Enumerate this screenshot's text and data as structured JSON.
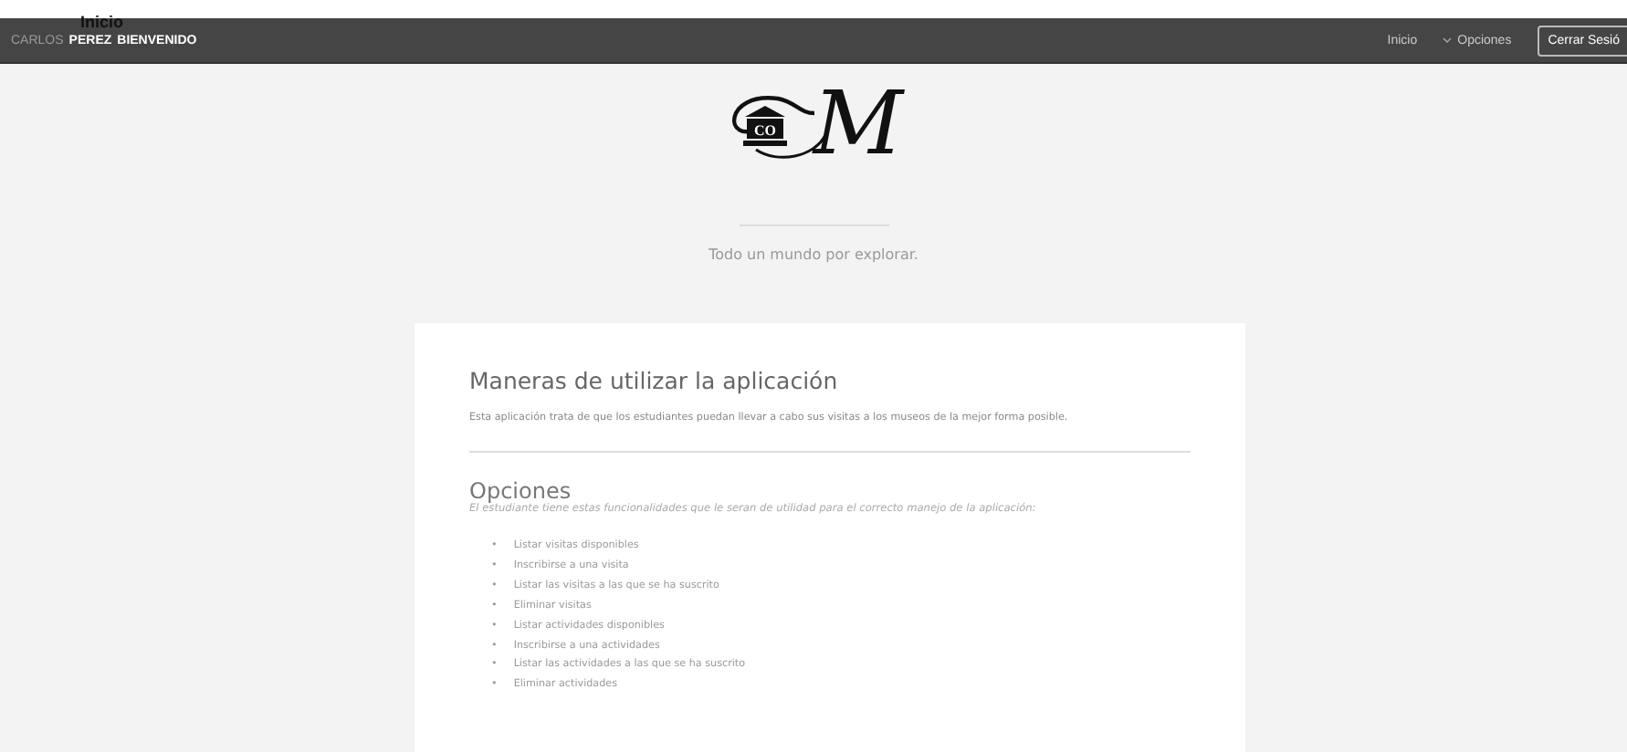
{
  "page_heading": "Inicio",
  "navbar": {
    "user": {
      "first_name": "CARLOS",
      "last_name": "PEREZ",
      "greeting": "BIENVENIDO"
    },
    "links": [
      {
        "label": "Inicio",
        "kind": "link"
      },
      {
        "label": "Opciones",
        "kind": "dropdown"
      }
    ],
    "logout_button": "Cerrar Sesió"
  },
  "hero": {
    "logo": {
      "badge_text": "CO",
      "letter": "M"
    },
    "tagline": "Todo un mundo por explorar."
  },
  "card": {
    "title": "Maneras de utilizar la aplicación",
    "description": "Esta aplicación trata de que los estudiantes puedan llevar a cabo sus visitas a los museos de la mejor forma posible.",
    "options_title": "Opciones",
    "options_subtitle": "El estudiante tiene estas funcionalidades que le seran de utilidad para el correcto manejo de la aplicación:",
    "bullet": "•",
    "options": [
      "Listar visitas disponibles",
      "Inscribirse a una visita",
      "Listar las visitas a las que se ha suscrito",
      "Eliminar visitas",
      "Listar actividades disponibles",
      "Inscribirse a una actividades",
      "Listar las actividades a las que se ha suscrito",
      "Eliminar actividades"
    ]
  }
}
